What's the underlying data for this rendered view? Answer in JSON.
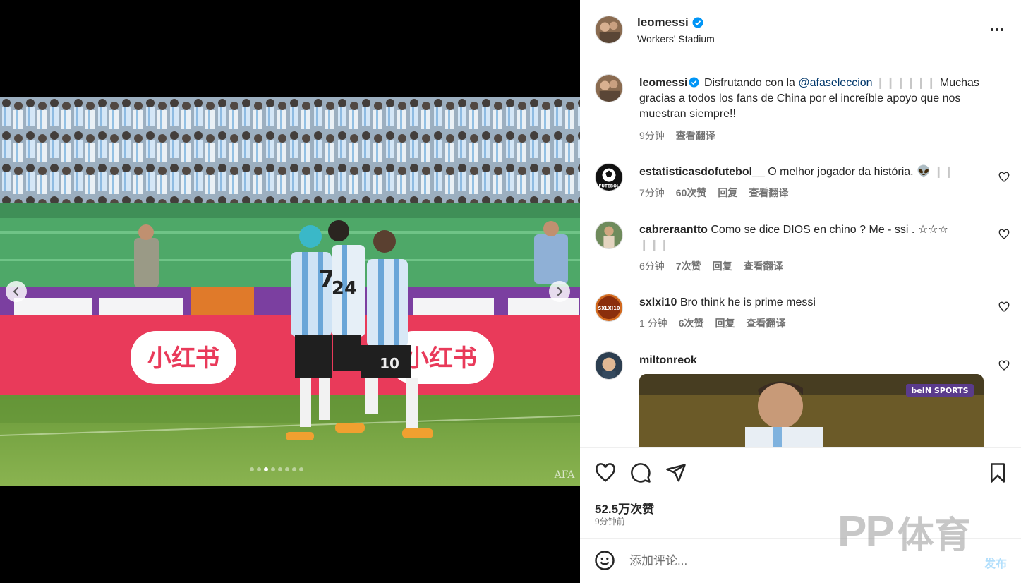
{
  "media": {
    "photo_ad_text_left": "小红书",
    "photo_ad_text_right": "小红书",
    "jersey_numbers": [
      "7",
      "24",
      "10"
    ],
    "watermark_letters": "AFA",
    "carousel_dots": 8,
    "carousel_active_index": 2
  },
  "header": {
    "username": "leomessi",
    "location": "Workers' Stadium"
  },
  "caption": {
    "username": "leomessi",
    "text_before": "Disfrutando con la",
    "mention": "@afaseleccion",
    "faint": "❙❙❙❙❙❙",
    "text_after": "Muchas gracias a todos los fans de China por el increíble apoyo que nos muestran siempre!!",
    "time": "9分钟",
    "translate": "查看翻译"
  },
  "comments": [
    {
      "username": "estatisticasdofutebol__",
      "text": "O melhor jogador da história. 👽",
      "faint": "❙❙",
      "time": "7分钟",
      "likes": "60次赞",
      "reply": "回复",
      "translate": "查看翻译",
      "avatar_label": "FUTEBOL"
    },
    {
      "username": "cabreraantto",
      "text": "Como se dice DIOS en chino ? Me - ssi . ☆☆☆",
      "faint": "❙❙❙",
      "time": "6分钟",
      "likes": "7次赞",
      "reply": "回复",
      "translate": "查看翻译"
    },
    {
      "username": "sxlxi10",
      "text": "Bro think he is prime messi",
      "time": "1 分钟",
      "likes": "6次赞",
      "reply": "回复",
      "translate": "查看翻译",
      "avatar_label": "SXLXI10"
    },
    {
      "username": "miltonreok",
      "text": "",
      "video_badge": "beIN SPORTS"
    }
  ],
  "actions": {
    "like_count": "52.5万次赞",
    "time": "9分钟前"
  },
  "comment_bar": {
    "placeholder": "添加评论...",
    "post_label": "发布"
  },
  "watermark": {
    "logo": "PP",
    "text": "体育"
  },
  "colors": {
    "verified": "#0095f6",
    "mention": "#00376b",
    "muted": "#737373",
    "post_button": "#b2dffc"
  }
}
